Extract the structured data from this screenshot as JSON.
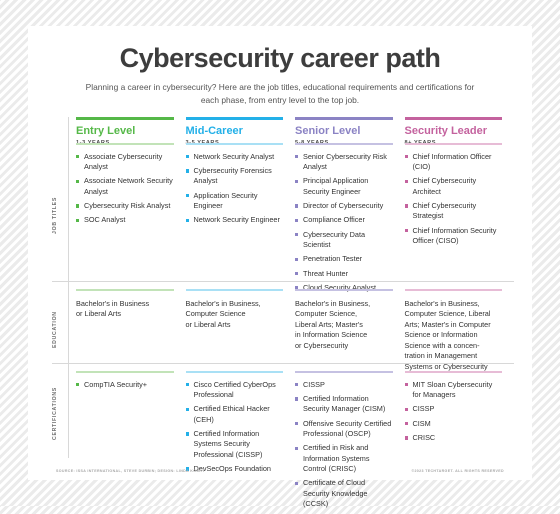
{
  "header": {
    "title": "Cybersecurity career path",
    "subtitle": "Planning a career in cybersecurity? Here are the job titles, educational requirements and certifications for each phase, from entry level to the top job."
  },
  "row_labels": {
    "job_titles": "JOB TITLES",
    "education": "EDUCATION",
    "certifications": "CERTIFICATIONS"
  },
  "colors": {
    "entry": "#55B848",
    "mid": "#23B0E8",
    "senior": "#8B83C4",
    "leader": "#C4629E",
    "entry_rule": "#c2e3b8",
    "mid_rule": "#a9e0f5",
    "senior_rule": "#c5c1e2",
    "leader_rule": "#e7bcd6",
    "divider": "#d8d8d8",
    "title": "#3d3d3d",
    "body": "#333333"
  },
  "columns": [
    {
      "name": "Entry Level",
      "years": "1-3 YEARS",
      "accent": "#55B848",
      "rule": "#c2e3b8",
      "job_titles": [
        "Associate Cybersecurity Analyst",
        "Associate Network Security Analyst",
        "Cybersecurity Risk Analyst",
        "SOC Analyst"
      ],
      "education": "Bachelor's in Business\nor Liberal Arts",
      "certifications": [
        "CompTIA Security+"
      ]
    },
    {
      "name": "Mid-Career",
      "years": "3-5 YEARS",
      "accent": "#23B0E8",
      "rule": "#a9e0f5",
      "job_titles": [
        "Network Security Analyst",
        "Cybersecurity Forensics Analyst",
        "Application Security Engineer",
        "Network Security Engineer"
      ],
      "education": "Bachelor's in Business,\nComputer Science\nor Liberal Arts",
      "certifications": [
        "Cisco Certified CyberOps Professional",
        "Certified Ethical Hacker (CEH)",
        "Certified Information Systems Security Professional (CISSP)",
        "DevSecOps Foundation"
      ]
    },
    {
      "name": "Senior Level",
      "years": "5-8 YEARS",
      "accent": "#8B83C4",
      "rule": "#c5c1e2",
      "job_titles": [
        "Senior Cybersecurity Risk Analyst",
        "Principal Application Security Engineer",
        "Director of Cybersecurity",
        "Compliance Officer",
        "Cybersecurity Data Scientist",
        "Penetration Tester",
        "Threat Hunter",
        "Cloud Security Analyst"
      ],
      "education": "Bachelor's in Business,\nComputer Science,\nLiberal Arts; Master's\nin Information Science\nor Cybersecurity",
      "certifications": [
        "CISSP",
        "Certified Information Security Manager (CISM)",
        "Offensive Security Certified Professional (OSCP)",
        "Certified in Risk and Information Systems Control (CRISC)",
        "Certificate of Cloud Security Knowledge (CCSK)"
      ]
    },
    {
      "name": "Security Leader",
      "years": "8+ YEARS",
      "accent": "#C4629E",
      "rule": "#e7bcd6",
      "job_titles": [
        "Chief Information Officer (CIO)",
        "Chief Cybersecurity Architect",
        "Chief Cybersecurity Strategist",
        "Chief Information Security Officer (CISO)"
      ],
      "education": "Bachelor's in Business,\nComputer Science, Liberal\nArts; Master's in Computer\nScience or Information\nScience with a concen-\ntration in Management\nSystems or Cybersecurity",
      "certifications": [
        "MIT Sloan Cybersecurity for Managers",
        "CISSP",
        "CISM",
        "CRISC"
      ]
    }
  ],
  "footer": {
    "source": "SOURCE: ISSA INTERNATIONAL, STEVE DURBIN; DESIGN: LINDA KOURY",
    "copyright": "©2023 TECHTARGET. ALL RIGHTS RESERVED"
  }
}
